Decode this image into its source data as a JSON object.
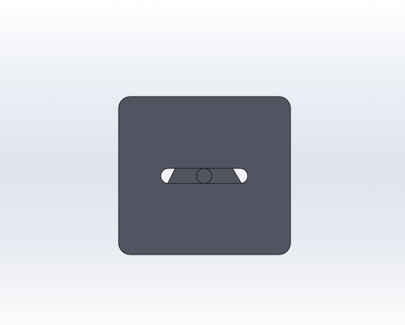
{
  "scene": {
    "background_top": "#ffffff",
    "background_mid": "#dfe3ec",
    "background_bottom": "#fbfbfc",
    "part_face_color": "#525561",
    "part_edge_color": "#1a1a1a",
    "slot_face_color": "#525561",
    "slot_gap_color": "#f2f3f7"
  }
}
